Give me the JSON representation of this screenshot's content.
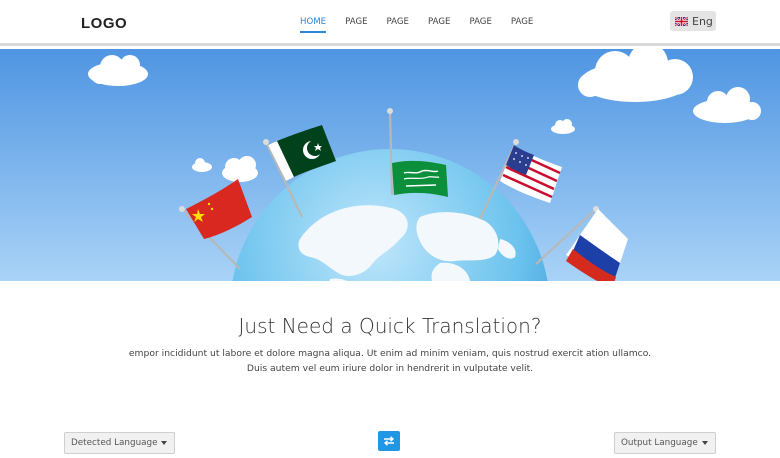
{
  "navbar": {
    "logo": "LOGO",
    "links": [
      {
        "label": "HOME",
        "active": true
      },
      {
        "label": "PAGE",
        "active": false
      },
      {
        "label": "PAGE",
        "active": false
      },
      {
        "label": "PAGE",
        "active": false
      },
      {
        "label": "PAGE",
        "active": false
      },
      {
        "label": "PAGE",
        "active": false
      }
    ],
    "language": {
      "label": "Eng",
      "flag": "uk-flag-icon"
    }
  },
  "hero": {
    "image": "world-flags-illustration",
    "flags": [
      "china-flag",
      "pakistan-flag",
      "saudi-arabia-flag",
      "usa-flag",
      "russia-flag"
    ]
  },
  "main": {
    "headline": "Just Need a Quick Translation?",
    "subtext_line1": "empor incididunt ut labore et dolore magna aliqua. Ut enim ad minim veniam, quis nostrud exercit ation ullamco.",
    "subtext_line2": "Duis autem vel eum iriure dolor in hendrerit in vulputate velit."
  },
  "translator": {
    "source_language": "Detected Language",
    "target_language": "Output Language",
    "swap_icon": "swap-arrows-icon"
  },
  "colors": {
    "accent": "#2a86d6",
    "swap_button": "#2196e3",
    "sky_top": "#4f95e2",
    "sky_bottom": "#a9d3f7"
  }
}
